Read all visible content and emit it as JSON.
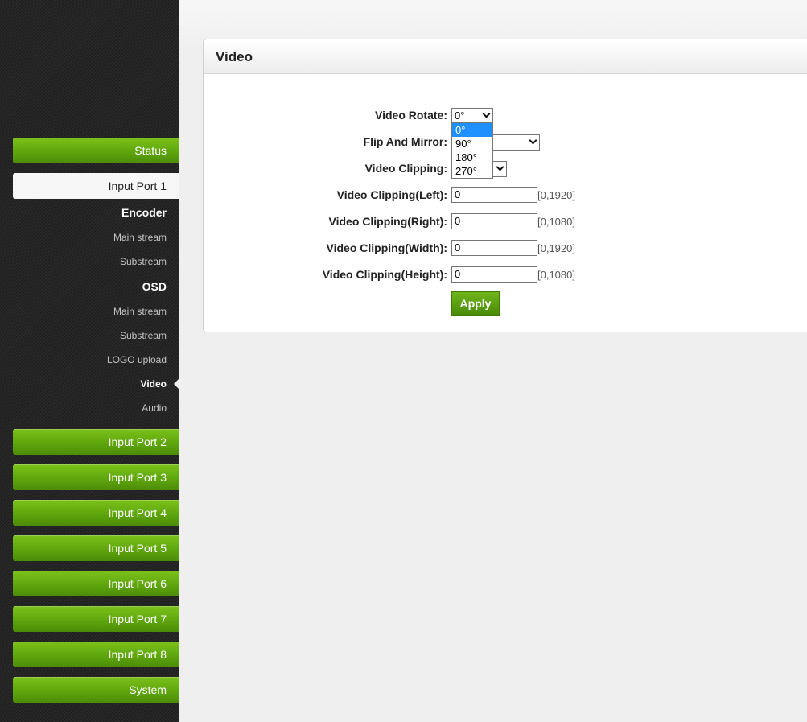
{
  "sidebar": {
    "status": "Status",
    "input_port_1": "Input Port 1",
    "encoder": "Encoder",
    "encoder_main": "Main stream",
    "encoder_sub": "Substream",
    "osd": "OSD",
    "osd_main": "Main stream",
    "osd_sub": "Substream",
    "logo_upload": "LOGO upload",
    "video": "Video",
    "audio": "Audio",
    "ports": [
      "Input Port 2",
      "Input Port 3",
      "Input Port 4",
      "Input Port 5",
      "Input Port 6",
      "Input Port 7",
      "Input Port 8"
    ],
    "system": "System"
  },
  "panel": {
    "title": "Video",
    "rotate_label": "Video Rotate:",
    "rotate_value": "0°",
    "rotate_options": [
      "0°",
      "90°",
      "180°",
      "270°"
    ],
    "flip_label": "Flip And Mirror:",
    "clipping_label": "Video Clipping:",
    "left_label": "Video Clipping(Left):",
    "left_value": "0",
    "left_range": "[0,1920]",
    "right_label": "Video Clipping(Right):",
    "right_value": "0",
    "right_range": "[0,1080]",
    "width_label": "Video Clipping(Width):",
    "width_value": "0",
    "width_range": "[0,1920]",
    "height_label": "Video Clipping(Height):",
    "height_value": "0",
    "height_range": "[0,1080]",
    "apply": "Apply"
  },
  "colors": {
    "green": "#5fa60e",
    "highlight": "#1e90ff"
  }
}
